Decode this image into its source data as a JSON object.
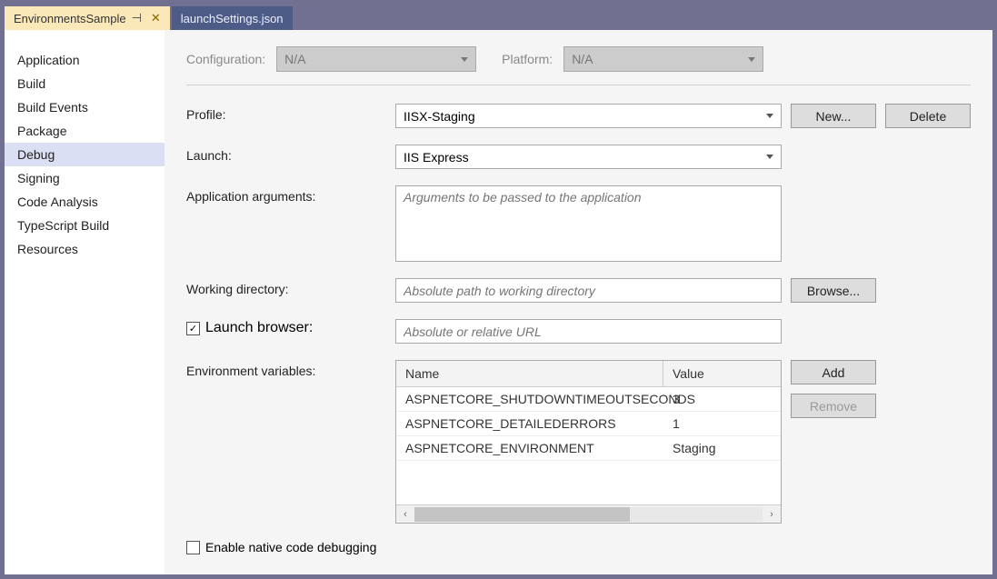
{
  "tabs": [
    {
      "label": "EnvironmentsSample",
      "active": true
    },
    {
      "label": "launchSettings.json",
      "active": false
    }
  ],
  "sidebar": {
    "items": [
      "Application",
      "Build",
      "Build Events",
      "Package",
      "Debug",
      "Signing",
      "Code Analysis",
      "TypeScript Build",
      "Resources"
    ],
    "activeIndex": 4
  },
  "topBar": {
    "configLabel": "Configuration:",
    "configValue": "N/A",
    "platformLabel": "Platform:",
    "platformValue": "N/A"
  },
  "form": {
    "profileLabel": "Profile:",
    "profileValue": "IISX-Staging",
    "newBtn": "New...",
    "deleteBtn": "Delete",
    "launchLabel": "Launch:",
    "launchValue": "IIS Express",
    "argsLabel": "Application arguments:",
    "argsPlaceholder": "Arguments to be passed to the application",
    "workDirLabel": "Working directory:",
    "workDirPlaceholder": "Absolute path to working directory",
    "browseBtn": "Browse...",
    "launchBrowserLabel": "Launch browser:",
    "launchBrowserChecked": true,
    "launchBrowserPlaceholder": "Absolute or relative URL",
    "envVarsLabel": "Environment variables:",
    "envHeaders": {
      "name": "Name",
      "value": "Value"
    },
    "envRows": [
      {
        "name": "ASPNETCORE_SHUTDOWNTIMEOUTSECONDS",
        "value": "3"
      },
      {
        "name": "ASPNETCORE_DETAILEDERRORS",
        "value": "1"
      },
      {
        "name": "ASPNETCORE_ENVIRONMENT",
        "value": "Staging"
      }
    ],
    "addBtn": "Add",
    "removeBtn": "Remove",
    "nativeDebugLabel": "Enable native code debugging",
    "nativeDebugChecked": false
  }
}
